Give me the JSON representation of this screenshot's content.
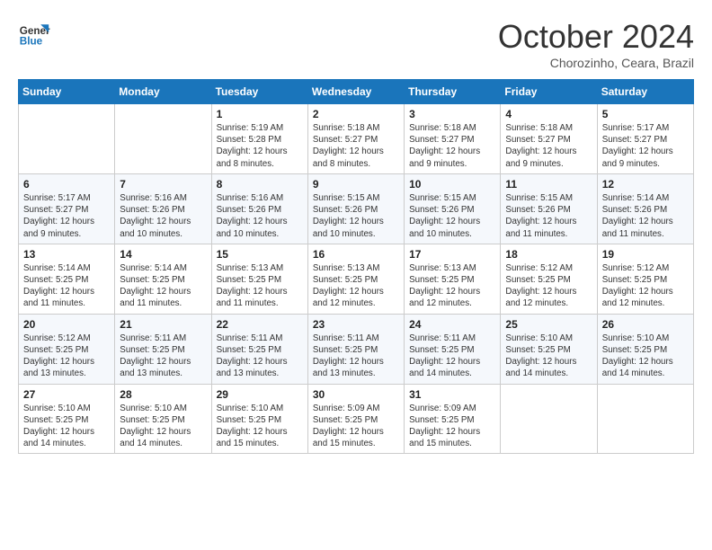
{
  "logo": {
    "line1": "General",
    "line2": "Blue"
  },
  "title": "October 2024",
  "subtitle": "Chorozinho, Ceara, Brazil",
  "headers": [
    "Sunday",
    "Monday",
    "Tuesday",
    "Wednesday",
    "Thursday",
    "Friday",
    "Saturday"
  ],
  "weeks": [
    [
      {
        "day": "",
        "info": ""
      },
      {
        "day": "",
        "info": ""
      },
      {
        "day": "1",
        "info": "Sunrise: 5:19 AM\nSunset: 5:28 PM\nDaylight: 12 hours\nand 8 minutes."
      },
      {
        "day": "2",
        "info": "Sunrise: 5:18 AM\nSunset: 5:27 PM\nDaylight: 12 hours\nand 8 minutes."
      },
      {
        "day": "3",
        "info": "Sunrise: 5:18 AM\nSunset: 5:27 PM\nDaylight: 12 hours\nand 9 minutes."
      },
      {
        "day": "4",
        "info": "Sunrise: 5:18 AM\nSunset: 5:27 PM\nDaylight: 12 hours\nand 9 minutes."
      },
      {
        "day": "5",
        "info": "Sunrise: 5:17 AM\nSunset: 5:27 PM\nDaylight: 12 hours\nand 9 minutes."
      }
    ],
    [
      {
        "day": "6",
        "info": "Sunrise: 5:17 AM\nSunset: 5:27 PM\nDaylight: 12 hours\nand 9 minutes."
      },
      {
        "day": "7",
        "info": "Sunrise: 5:16 AM\nSunset: 5:26 PM\nDaylight: 12 hours\nand 10 minutes."
      },
      {
        "day": "8",
        "info": "Sunrise: 5:16 AM\nSunset: 5:26 PM\nDaylight: 12 hours\nand 10 minutes."
      },
      {
        "day": "9",
        "info": "Sunrise: 5:15 AM\nSunset: 5:26 PM\nDaylight: 12 hours\nand 10 minutes."
      },
      {
        "day": "10",
        "info": "Sunrise: 5:15 AM\nSunset: 5:26 PM\nDaylight: 12 hours\nand 10 minutes."
      },
      {
        "day": "11",
        "info": "Sunrise: 5:15 AM\nSunset: 5:26 PM\nDaylight: 12 hours\nand 11 minutes."
      },
      {
        "day": "12",
        "info": "Sunrise: 5:14 AM\nSunset: 5:26 PM\nDaylight: 12 hours\nand 11 minutes."
      }
    ],
    [
      {
        "day": "13",
        "info": "Sunrise: 5:14 AM\nSunset: 5:25 PM\nDaylight: 12 hours\nand 11 minutes."
      },
      {
        "day": "14",
        "info": "Sunrise: 5:14 AM\nSunset: 5:25 PM\nDaylight: 12 hours\nand 11 minutes."
      },
      {
        "day": "15",
        "info": "Sunrise: 5:13 AM\nSunset: 5:25 PM\nDaylight: 12 hours\nand 11 minutes."
      },
      {
        "day": "16",
        "info": "Sunrise: 5:13 AM\nSunset: 5:25 PM\nDaylight: 12 hours\nand 12 minutes."
      },
      {
        "day": "17",
        "info": "Sunrise: 5:13 AM\nSunset: 5:25 PM\nDaylight: 12 hours\nand 12 minutes."
      },
      {
        "day": "18",
        "info": "Sunrise: 5:12 AM\nSunset: 5:25 PM\nDaylight: 12 hours\nand 12 minutes."
      },
      {
        "day": "19",
        "info": "Sunrise: 5:12 AM\nSunset: 5:25 PM\nDaylight: 12 hours\nand 12 minutes."
      }
    ],
    [
      {
        "day": "20",
        "info": "Sunrise: 5:12 AM\nSunset: 5:25 PM\nDaylight: 12 hours\nand 13 minutes."
      },
      {
        "day": "21",
        "info": "Sunrise: 5:11 AM\nSunset: 5:25 PM\nDaylight: 12 hours\nand 13 minutes."
      },
      {
        "day": "22",
        "info": "Sunrise: 5:11 AM\nSunset: 5:25 PM\nDaylight: 12 hours\nand 13 minutes."
      },
      {
        "day": "23",
        "info": "Sunrise: 5:11 AM\nSunset: 5:25 PM\nDaylight: 12 hours\nand 13 minutes."
      },
      {
        "day": "24",
        "info": "Sunrise: 5:11 AM\nSunset: 5:25 PM\nDaylight: 12 hours\nand 14 minutes."
      },
      {
        "day": "25",
        "info": "Sunrise: 5:10 AM\nSunset: 5:25 PM\nDaylight: 12 hours\nand 14 minutes."
      },
      {
        "day": "26",
        "info": "Sunrise: 5:10 AM\nSunset: 5:25 PM\nDaylight: 12 hours\nand 14 minutes."
      }
    ],
    [
      {
        "day": "27",
        "info": "Sunrise: 5:10 AM\nSunset: 5:25 PM\nDaylight: 12 hours\nand 14 minutes."
      },
      {
        "day": "28",
        "info": "Sunrise: 5:10 AM\nSunset: 5:25 PM\nDaylight: 12 hours\nand 14 minutes."
      },
      {
        "day": "29",
        "info": "Sunrise: 5:10 AM\nSunset: 5:25 PM\nDaylight: 12 hours\nand 15 minutes."
      },
      {
        "day": "30",
        "info": "Sunrise: 5:09 AM\nSunset: 5:25 PM\nDaylight: 12 hours\nand 15 minutes."
      },
      {
        "day": "31",
        "info": "Sunrise: 5:09 AM\nSunset: 5:25 PM\nDaylight: 12 hours\nand 15 minutes."
      },
      {
        "day": "",
        "info": ""
      },
      {
        "day": "",
        "info": ""
      }
    ]
  ]
}
